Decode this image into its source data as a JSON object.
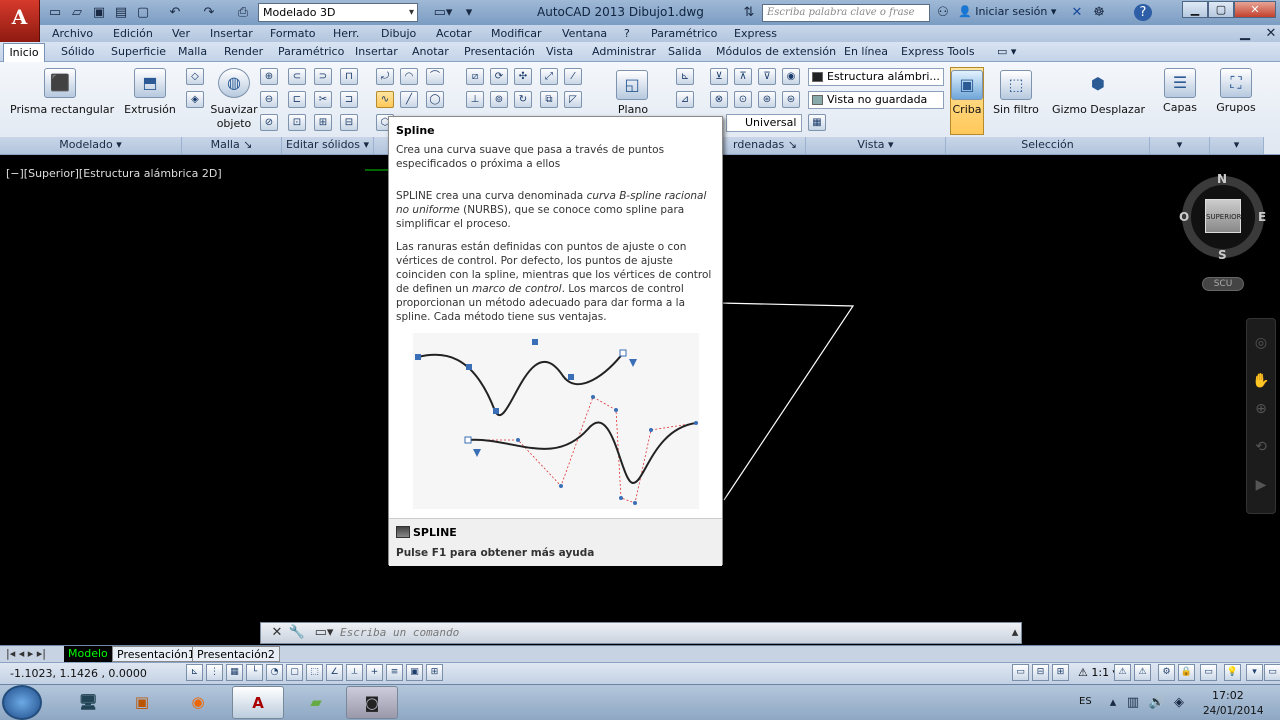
{
  "app": {
    "title": "AutoCAD 2013   Dibujo1.dwg",
    "workspace": "Modelado 3D",
    "search_placeholder": "Escriba palabra clave o frase",
    "login": "Iniciar sesión"
  },
  "menu": [
    "Archivo",
    "Edición",
    "Ver",
    "Insertar",
    "Formato",
    "Herr.",
    "Dibujo",
    "Acotar",
    "Modificar",
    "Ventana",
    "?",
    "Paramétrico",
    "Express"
  ],
  "tabs": [
    "Inicio",
    "Sólido",
    "Superficie",
    "Malla",
    "Render",
    "Paramétrico",
    "Insertar",
    "Anotar",
    "Presentación",
    "Vista",
    "Administrar",
    "Salida",
    "Módulos de extensión",
    "En línea",
    "Express Tools"
  ],
  "ribbon": {
    "prisma": "Prisma rectangular",
    "extrusion": "Extrusión",
    "suavizar1": "Suavizar",
    "suavizar2": "objeto",
    "plano": "Plano",
    "universal": "Universal",
    "estilo": "Estructura alámbri...",
    "vista": "Vista no guardada",
    "criba": "Criba",
    "sinfiltro": "Sin filtro",
    "gizmo": "Gizmo Desplazar",
    "capas": "Capas",
    "grupos": "Grupos"
  },
  "panels": {
    "modelado": "Modelado",
    "malla": "Malla",
    "editar": "Editar sólidos",
    "coordenadas": "rdenadas",
    "vista": "Vista",
    "seleccion": "Selección"
  },
  "viewport": {
    "label": "[−][Superior][Estructura alámbrica 2D]",
    "cube": "SUPERIOR",
    "n": "N",
    "s": "S",
    "o": "O",
    "e": "E",
    "scu": "SCU"
  },
  "tooltip": {
    "title": "Spline",
    "p1": "Crea una curva suave que pasa a través de puntos especificados o próxima a ellos",
    "p2a": "SPLINE crea una curva denominada ",
    "p2b": "curva B-spline racional no uniforme",
    "p2c": " (NURBS), que se conoce como spline para simplificar el proceso.",
    "p3a": "Las ranuras están definidas con puntos de ajuste o con vértices de control. Por defecto, los puntos de ajuste coinciden con la spline, mientras que los vértices de control de definen un ",
    "p3b": "marco de control",
    "p3c": ". Los marcos de control proporcionan un método adecuado para dar forma a la spline. Cada método tiene sus ventajas.",
    "command": "SPLINE",
    "help": "Pulse F1 para obtener más ayuda"
  },
  "command_line": {
    "placeholder": "Escriba un comando"
  },
  "layout_tabs": [
    "Modelo",
    "Presentación1",
    "Presentación2"
  ],
  "status": {
    "coords": "-1.1023, 1.1426 , 0.0000",
    "scale": "1:1"
  },
  "taskbar": {
    "lang": "ES",
    "time": "17:02",
    "date": "24/01/2014"
  },
  "colors": {
    "accent": "#ffc85a",
    "model_tab": "#00ff00"
  }
}
